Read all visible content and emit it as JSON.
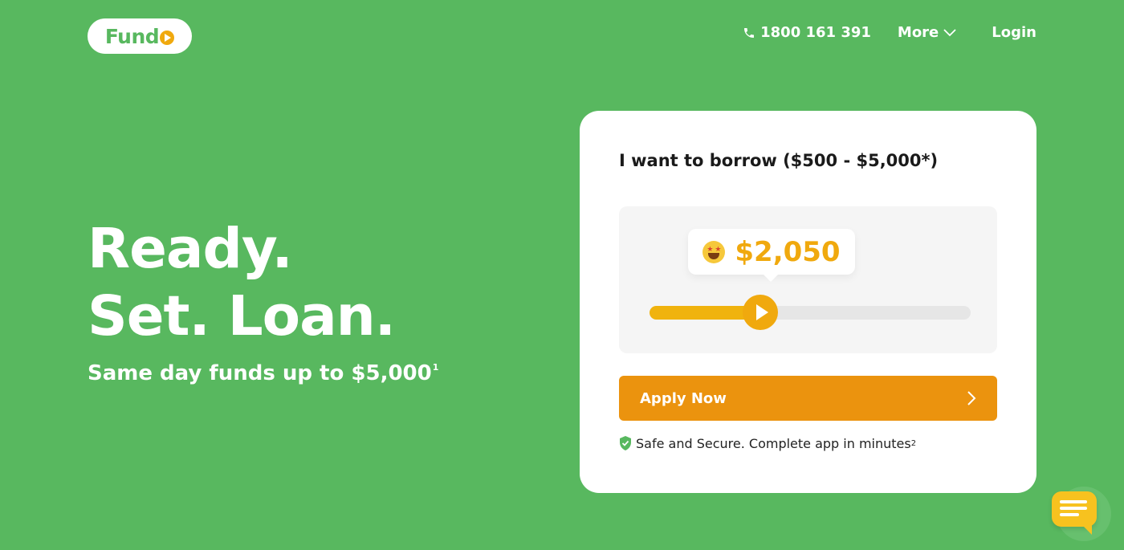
{
  "header": {
    "logo_text": "Fund",
    "phone": "1800 161 391",
    "more_label": "More",
    "login_label": "Login"
  },
  "hero": {
    "title_line1": "Ready.",
    "title_line2": "Set. Loan.",
    "subtitle": "Same day funds up to $5,000",
    "subtitle_sup": "1"
  },
  "card": {
    "heading": "I want to borrow ($500 - $5,000*)",
    "slider": {
      "min": 500,
      "max": 5000,
      "value": 2050,
      "display": "$2,050",
      "emoji": "star-struck-emoji"
    },
    "apply_label": "Apply Now",
    "secure_text": "Safe and Secure. Complete app in minutes",
    "secure_sup": "2"
  },
  "colors": {
    "brand_green": "#58b85f",
    "accent_orange": "#eb930e",
    "amount_gold": "#f0a90e"
  },
  "icons": {
    "phone": "phone-icon",
    "more": "chevron-down-icon",
    "apply": "chevron-right-icon",
    "secure": "shield-check-icon",
    "chat": "chat-icon"
  }
}
